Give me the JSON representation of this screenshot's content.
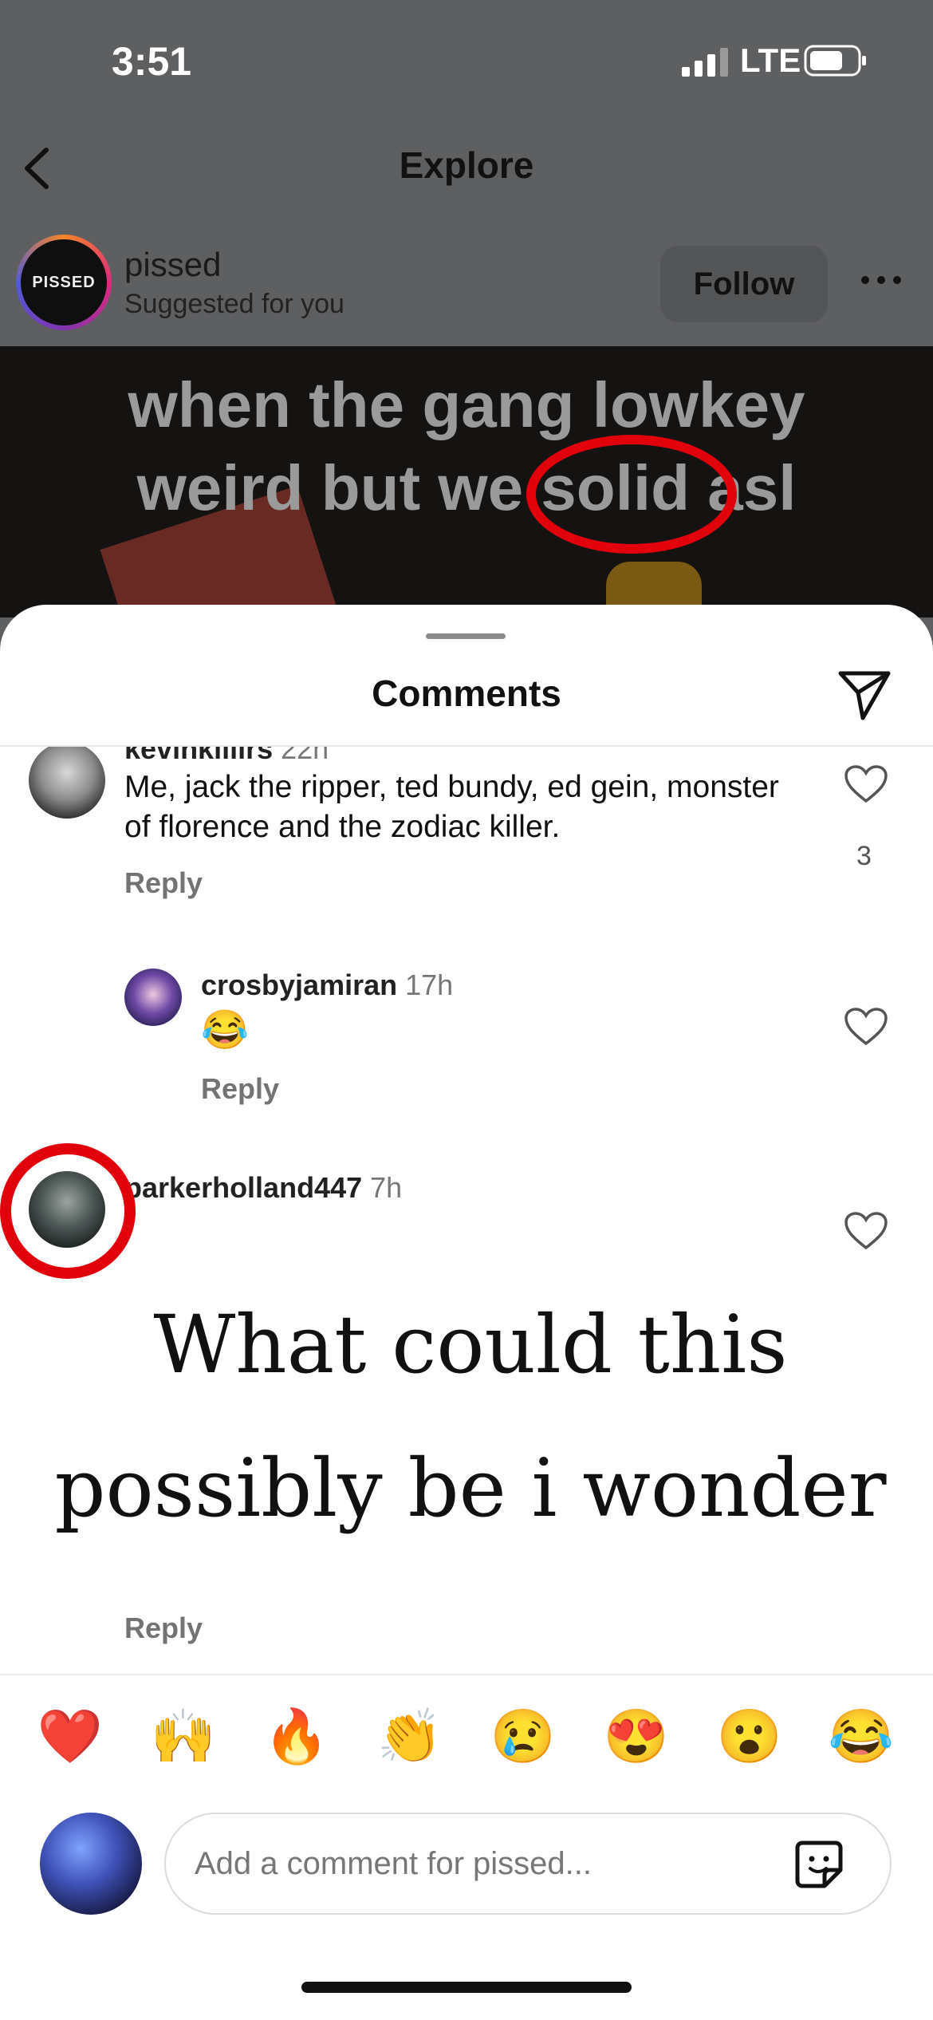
{
  "status_bar": {
    "time": "3:51",
    "network": "LTE"
  },
  "nav": {
    "title": "Explore"
  },
  "post": {
    "avatar_text": "PISSED",
    "username": "pissed",
    "subtitle": "Suggested for you",
    "follow_label": "Follow",
    "caption_line1": "when the gang lowkey",
    "caption_line2": "weird but we solid asl"
  },
  "sheet": {
    "title": "Comments"
  },
  "comments": [
    {
      "username": "kevinkillirs",
      "time": "22h",
      "text": "Me, jack the ripper, ted bundy, ed gein, monster of florence and the zodiac killer.",
      "reply_label": "Reply",
      "likes": "3"
    },
    {
      "username": "crosbyjamiran",
      "time": "17h",
      "emoji": "😂",
      "reply_label": "Reply"
    },
    {
      "username": "parkerholland447",
      "time": "7h",
      "handwritten_line1": "What could this",
      "handwritten_line2": "possibly be i wonder",
      "reply_label": "Reply"
    }
  ],
  "emoji_bar": [
    "❤️",
    "🙌",
    "🔥",
    "👏",
    "😢",
    "😍",
    "😮",
    "😂"
  ],
  "composer": {
    "placeholder": "Add a comment for pissed..."
  },
  "colors": {
    "annotation_red": "#e1010a",
    "overlay": "#5e5f61"
  }
}
